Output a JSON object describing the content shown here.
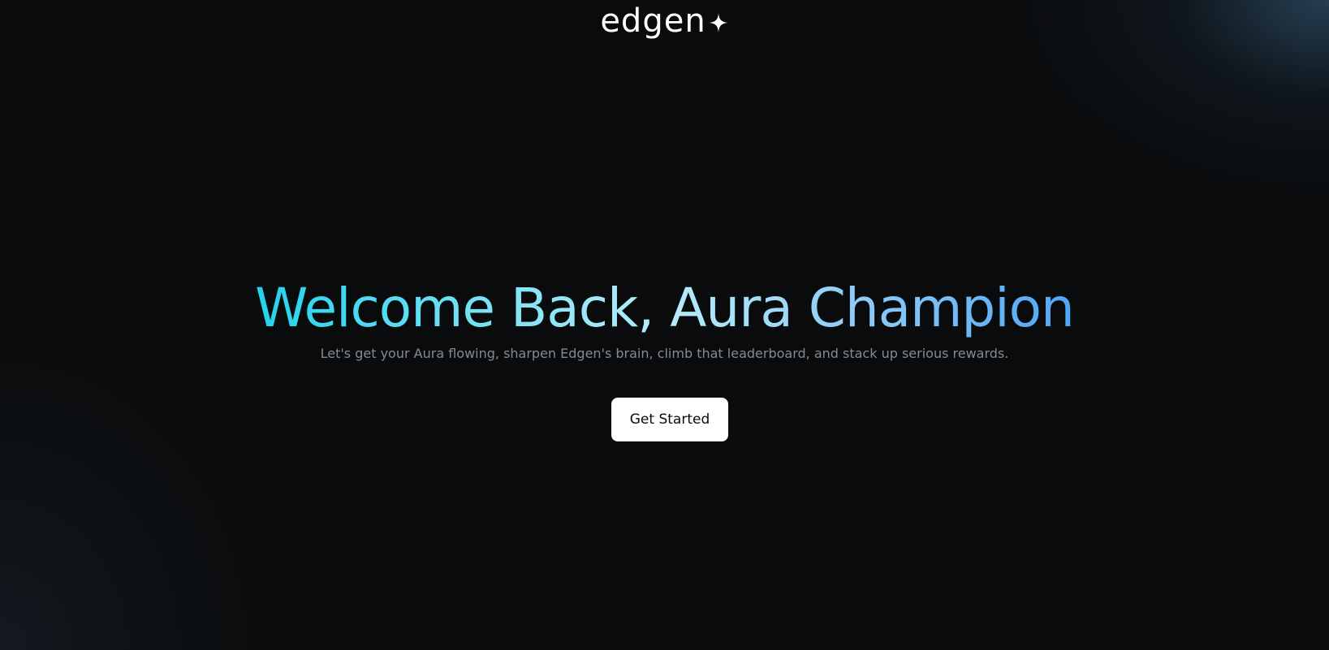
{
  "brand": {
    "logo_text": "edgen",
    "logo_icon": "sparkle-icon"
  },
  "hero": {
    "title": "Welcome Back, Aura Champion",
    "subtitle": "Let's get your Aura flowing, sharpen Edgen's brain, climb that leaderboard, and stack up serious rewards."
  },
  "cta": {
    "label": "Get Started"
  },
  "colors": {
    "background": "#0a0b0c",
    "title_gradient_start": "#22d3ee",
    "title_gradient_end": "#4ea5f6",
    "subtitle": "#858b90",
    "button_bg": "#ffffff",
    "button_text": "#0a0b0c"
  }
}
